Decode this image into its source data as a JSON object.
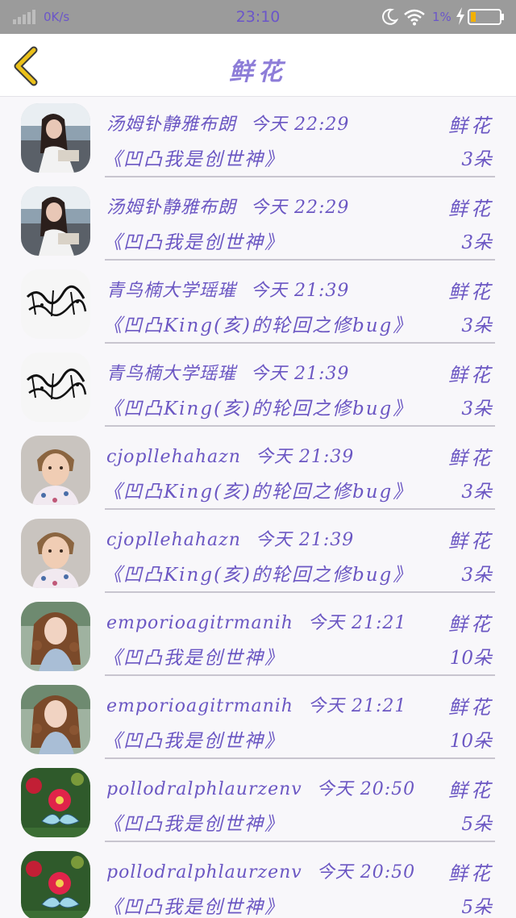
{
  "status_bar": {
    "network_speed": "0K/s",
    "time": "23:10",
    "battery_percent": "1%",
    "icons": [
      "signal-icon",
      "moon-icon",
      "wifi-icon",
      "charging-bolt-icon",
      "battery-icon"
    ],
    "text_color": "#6b56c9",
    "battery_color": "#f2b000"
  },
  "header": {
    "title": "鲜花",
    "back_icon": "chevron-left-icon",
    "back_icon_color": "#ebc11a"
  },
  "rows": [
    {
      "sender": "汤姆钋静雅布朗",
      "time": "今天 22:29",
      "gift": "鲜花",
      "novel": "《凹凸我是创世神》",
      "count": "3朵",
      "avatar": "girl-by-sea"
    },
    {
      "sender": "汤姆钋静雅布朗",
      "time": "今天 22:29",
      "gift": "鲜花",
      "novel": "《凹凸我是创世神》",
      "count": "3朵",
      "avatar": "girl-by-sea"
    },
    {
      "sender": "青鸟楠大学瑶璀",
      "time": "今天 21:39",
      "gift": "鲜花",
      "novel": "《凹凸King(亥)的轮回之修bug》",
      "count": "3朵",
      "avatar": "calligraphy"
    },
    {
      "sender": "青鸟楠大学瑶璀",
      "time": "今天 21:39",
      "gift": "鲜花",
      "novel": "《凹凸King(亥)的轮回之修bug》",
      "count": "3朵",
      "avatar": "calligraphy"
    },
    {
      "sender": "cjopllehahazn",
      "time": "今天 21:39",
      "gift": "鲜花",
      "novel": "《凹凸King(亥)的轮回之修bug》",
      "count": "3朵",
      "avatar": "child-portrait"
    },
    {
      "sender": "cjopllehahazn",
      "time": "今天 21:39",
      "gift": "鲜花",
      "novel": "《凹凸King(亥)的轮回之修bug》",
      "count": "3朵",
      "avatar": "child-portrait"
    },
    {
      "sender": "emporioagitrmanih",
      "time": "今天 21:21",
      "gift": "鲜花",
      "novel": "《凹凸我是创世神》",
      "count": "10朵",
      "avatar": "curly-hair-girl"
    },
    {
      "sender": "emporioagitrmanih",
      "time": "今天 21:21",
      "gift": "鲜花",
      "novel": "《凹凸我是创世神》",
      "count": "10朵",
      "avatar": "curly-hair-girl"
    },
    {
      "sender": "pollodralphlaurzenv",
      "time": "今天 20:50",
      "gift": "鲜花",
      "novel": "《凹凸我是创世神》",
      "count": "5朵",
      "avatar": "butterfly-flower"
    },
    {
      "sender": "pollodralphlaurzenv",
      "time": "今天 20:50",
      "gift": "鲜花",
      "novel": "《凹凸我是创世神》",
      "count": "5朵",
      "avatar": "butterfly-flower"
    }
  ]
}
